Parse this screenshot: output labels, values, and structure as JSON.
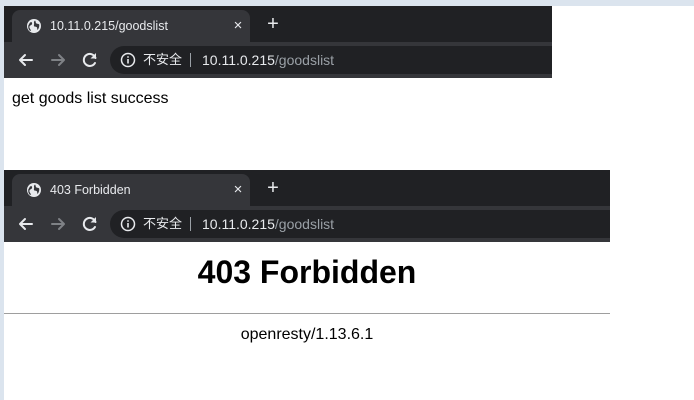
{
  "windows": [
    {
      "tab": {
        "title": "10.11.0.215/goodslist",
        "icon": "globe-icon"
      },
      "toolbar": {
        "security_label": "不安全",
        "url_host": "10.11.0.215",
        "url_path": "/goodslist"
      },
      "content": {
        "text": "get goods list success"
      }
    },
    {
      "tab": {
        "title": "403 Forbidden",
        "icon": "globe-icon"
      },
      "toolbar": {
        "security_label": "不安全",
        "url_host": "10.11.0.215",
        "url_path": "/goodslist"
      },
      "content": {
        "heading": "403 Forbidden",
        "server": "openresty/1.13.6.1"
      }
    }
  ],
  "icons": {
    "tab_close": "×",
    "new_tab": "+"
  },
  "colors": {
    "tabstrip": "#202124",
    "active_tab": "#35363a",
    "omnibox": "#202124",
    "text_light": "#e8eaed",
    "text_dim": "#9aa0a6"
  }
}
